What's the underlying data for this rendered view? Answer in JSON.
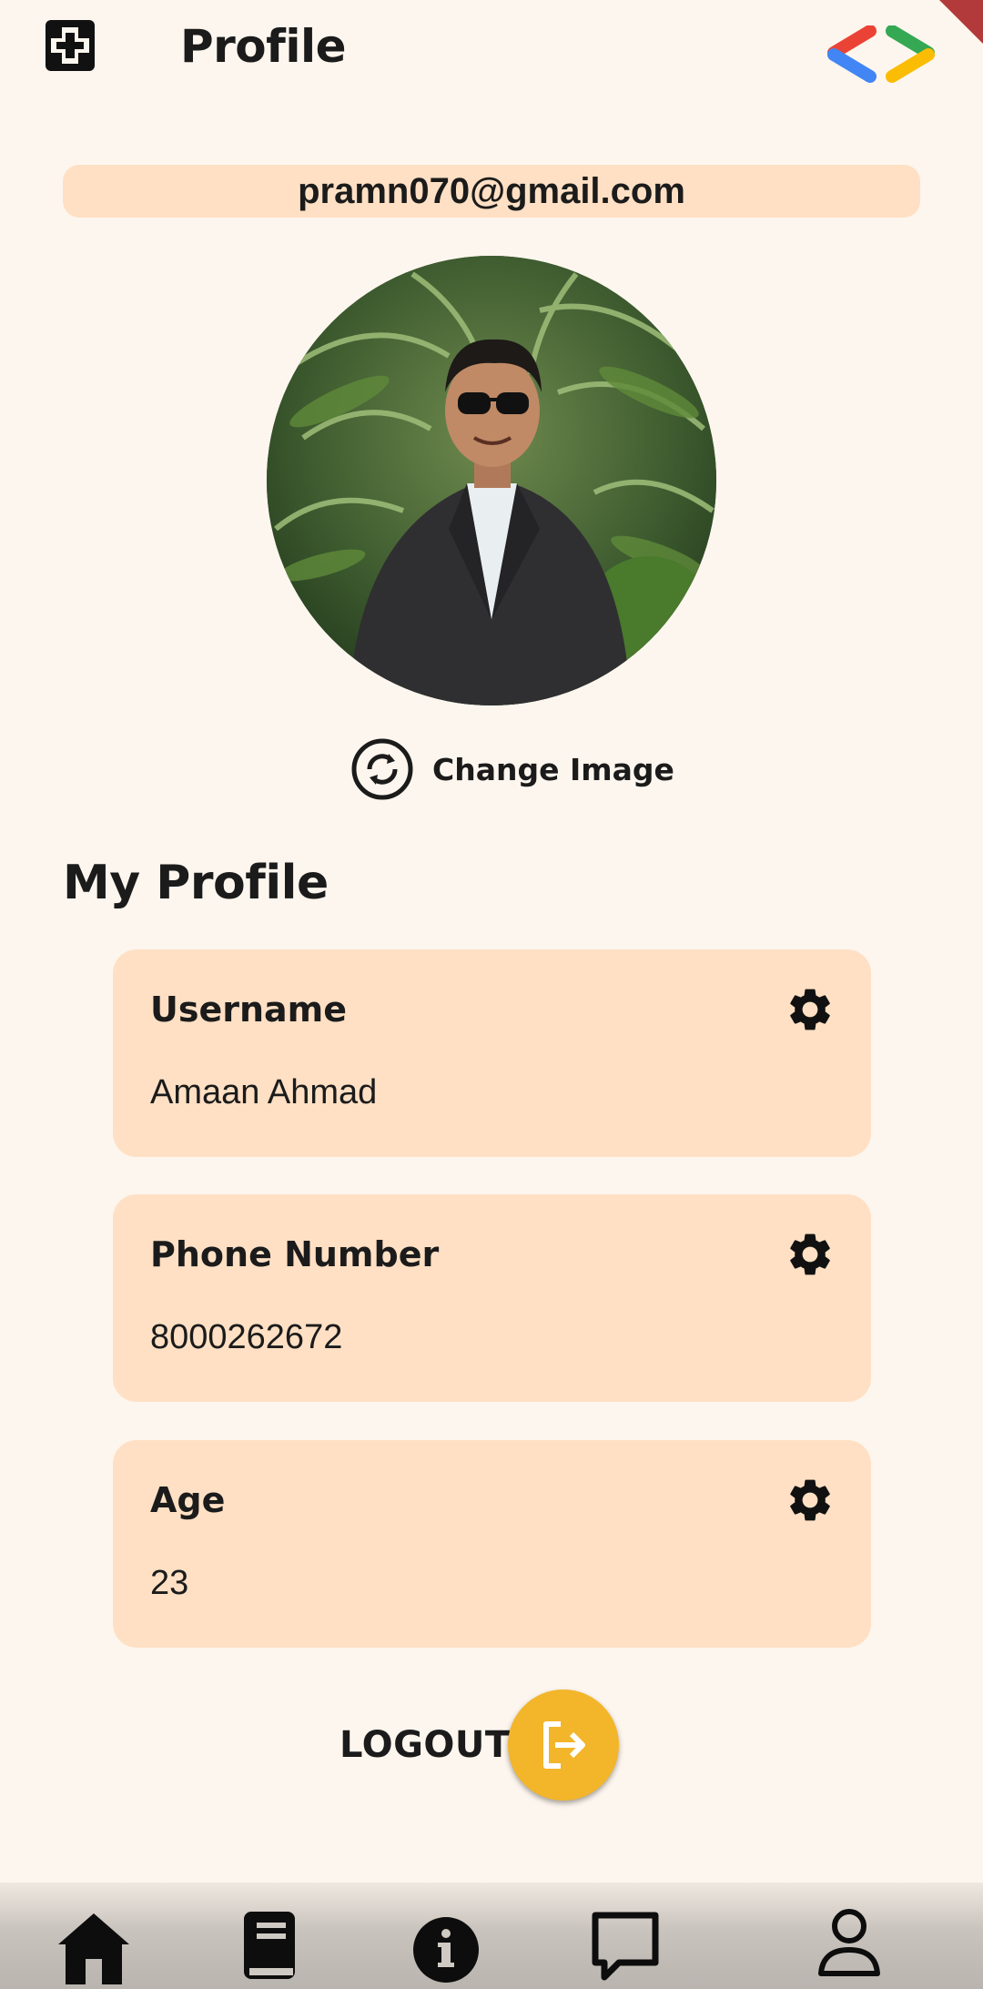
{
  "app_bar": {
    "title": "Profile",
    "menu_icon": "medical-cross-icon",
    "logo_icon": "gdg-logo-icon"
  },
  "profile": {
    "email": "pramn070@gmail.com",
    "change_image_label": "Change Image",
    "change_image_icon": "refresh-circle-icon"
  },
  "section": {
    "title": "My Profile"
  },
  "fields": [
    {
      "label": "Username",
      "value": "Amaan Ahmad",
      "icon": "gear-icon"
    },
    {
      "label": "Phone Number",
      "value": "8000262672",
      "icon": "gear-icon"
    },
    {
      "label": "Age",
      "value": "23",
      "icon": "gear-icon"
    }
  ],
  "logout": {
    "label": "LOGOUT",
    "icon": "logout-icon"
  },
  "bottom_nav": {
    "items": [
      {
        "icon": "home-icon"
      },
      {
        "icon": "book-icon"
      },
      {
        "icon": "info-icon"
      },
      {
        "icon": "chat-icon"
      },
      {
        "icon": "person-icon"
      }
    ]
  },
  "colors": {
    "background": "#fdf6ee",
    "card": "#ffe0c4",
    "accent": "#f3b52a",
    "text": "#1b1b1b"
  }
}
